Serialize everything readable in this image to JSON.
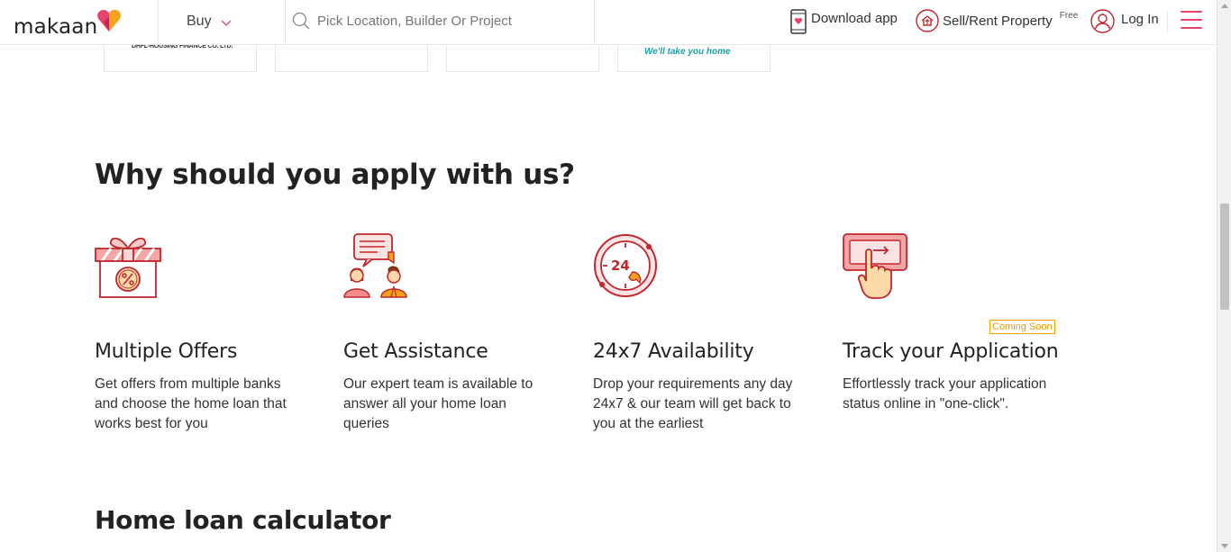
{
  "header": {
    "logo_text": "makaan",
    "buy_label": "Buy",
    "search_placeholder": "Pick Location, Builder Or Project",
    "download_label": "Download app",
    "sell_label": "Sell/Rent Property",
    "free_label": "Free",
    "login_label": "Log In"
  },
  "partners": {
    "dhfl_label": "DHFL-HOUSING FINANCE CO. LTD.",
    "hfc_tagline": "We'll take you home"
  },
  "why_section": {
    "title": "Why should you apply with us?",
    "features": [
      {
        "icon": "gift-percent-icon",
        "title": "Multiple Offers",
        "description": "Get offers from multiple banks and choose the home loan that works best for you"
      },
      {
        "icon": "assistance-chat-icon",
        "title": "Get Assistance",
        "description": "Our expert team is available to answer all your home loan queries"
      },
      {
        "icon": "clock-24x7-icon",
        "title": "24x7 Availability",
        "description": "Drop your requirements any day 24x7 & our team will get back to you at the earliest"
      },
      {
        "icon": "tap-track-icon",
        "title": "Track your Application",
        "description": "Effortlessly track your application status online in \"one-click\".",
        "badge": "Coming Soon"
      }
    ]
  },
  "calculator": {
    "title": "Home loan calculator"
  },
  "colors": {
    "brand_pink": "#e5436c",
    "icon_red": "#c1272d",
    "badge_orange": "#f0a500"
  }
}
